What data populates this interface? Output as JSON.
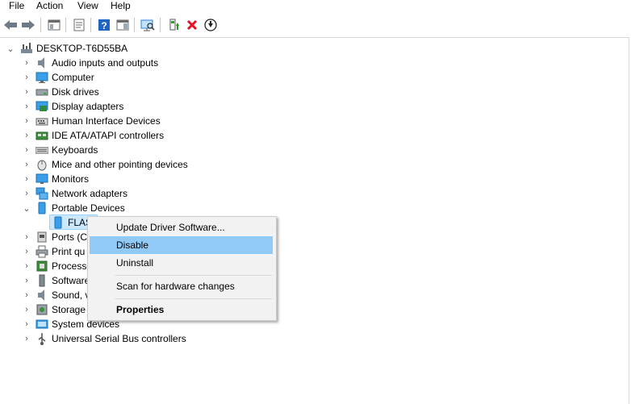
{
  "menu": [
    "File",
    "Action",
    "View",
    "Help"
  ],
  "toolbar": {
    "back": "back-arrow-icon",
    "forward": "forward-arrow-icon",
    "show_hide_console": "console-tree-icon",
    "properties": "properties-icon",
    "help": "help-icon",
    "action_pane": "action-pane-icon",
    "scan": "scan-hardware-icon",
    "update_driver": "update-driver-icon",
    "uninstall": "uninstall-x-icon",
    "disable": "disable-device-icon"
  },
  "tree": {
    "root": "DESKTOP-T6D55BA",
    "categories": [
      "Audio inputs and outputs",
      "Computer",
      "Disk drives",
      "Display adapters",
      "Human Interface Devices",
      "IDE ATA/ATAPI controllers",
      "Keyboards",
      "Mice and other pointing devices",
      "Monitors",
      "Network adapters",
      "Portable Devices",
      "Ports (C",
      "Print qu",
      "Processo",
      "Software",
      "Sound, v",
      "Storage",
      "System devices",
      "Universal Serial Bus controllers"
    ],
    "expanded_child": "FLAS"
  },
  "context_menu": {
    "items": [
      "Update Driver Software...",
      "Disable",
      "Uninstall",
      "Scan for hardware changes",
      "Properties"
    ],
    "highlighted": "Disable"
  },
  "colors": {
    "selection": "#cce8ff",
    "menu_highlight": "#91c9f7",
    "uninstall_red": "#e81123"
  }
}
